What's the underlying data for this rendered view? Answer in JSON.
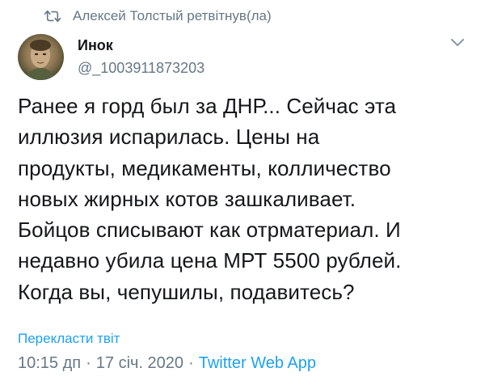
{
  "retweet": {
    "icon": "retweet-icon",
    "text": "Алексей Толстый ретвітнув(ла)"
  },
  "author": {
    "avatar": "avatar",
    "name": "Инок",
    "handle": "@_1003911873203"
  },
  "menu_icon": "chevron-down-icon",
  "tweet": {
    "text": "Ранее я горд был за ДНР... Сейчас эта\nиллюзия испарилась. Цены на\nпродукты, медикаменты, колличество\nновых жирных котов зашкаливает.\nБойцов списывают как отрматериал.  И\nнедавно убила цена МРТ  5500 рублей.\nКогда вы, чепушилы, подавитесь?"
  },
  "translate_label": "Перекласти твіт",
  "meta": {
    "time": "10:15 дп",
    "separator": "·",
    "date": "17 січ. 2020",
    "source": "Twitter Web App"
  },
  "colors": {
    "text": "#14171a",
    "secondary": "#657786",
    "link": "#1da1f2"
  }
}
